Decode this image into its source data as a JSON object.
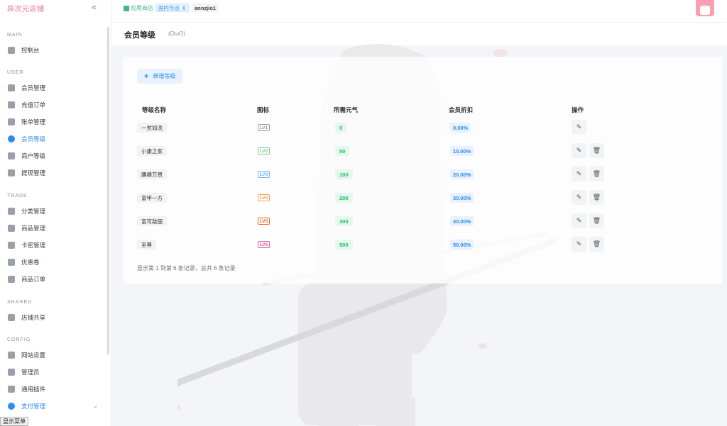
{
  "brand": "异次元店铺",
  "sidebar": {
    "sections": [
      {
        "title": "MAIN",
        "items": [
          {
            "label": "控制台",
            "icon": "dashboard-icon"
          }
        ]
      },
      {
        "title": "USER",
        "items": [
          {
            "label": "会员管理",
            "icon": "user-icon"
          },
          {
            "label": "充值订单",
            "icon": "recharge-icon"
          },
          {
            "label": "账单管理",
            "icon": "bill-icon"
          },
          {
            "label": "会员等级",
            "icon": "level-icon",
            "active": true
          },
          {
            "label": "商户等级",
            "icon": "merchant-icon"
          },
          {
            "label": "提现管理",
            "icon": "withdraw-icon"
          }
        ]
      },
      {
        "title": "TRADE",
        "items": [
          {
            "label": "分类管理",
            "icon": "category-icon"
          },
          {
            "label": "商品管理",
            "icon": "goods-icon"
          },
          {
            "label": "卡密管理",
            "icon": "card-icon"
          },
          {
            "label": "优惠卷",
            "icon": "coupon-icon"
          },
          {
            "label": "商品订单",
            "icon": "order-icon"
          }
        ]
      },
      {
        "title": "SHARED",
        "items": [
          {
            "label": "店铺共享",
            "icon": "share-icon"
          }
        ]
      },
      {
        "title": "CONFIG",
        "items": [
          {
            "label": "网站设置",
            "icon": "settings-icon"
          },
          {
            "label": "管理员",
            "icon": "admin-icon"
          },
          {
            "label": "通用插件",
            "icon": "plugin-icon"
          },
          {
            "label": "支付管理",
            "icon": "payment-icon",
            "highlight": true
          }
        ]
      }
    ],
    "menu_button": "显示菜单"
  },
  "topbar": {
    "store_link": "应用商店",
    "node": "国内节点",
    "username": "annzjio1"
  },
  "page": {
    "title": "会员等级",
    "subtitle": "(OωO)"
  },
  "table": {
    "add_button": "新增等级",
    "headers": [
      "等级名称",
      "图标",
      "所需元气",
      "会员折扣",
      "操作"
    ],
    "rows": [
      {
        "name": "一贫如洗",
        "icon": "LV1",
        "icon_color": "#9a9a9a",
        "need": "0",
        "discount": "0.00%",
        "deletable": false
      },
      {
        "name": "小康之家",
        "icon": "LV2",
        "icon_color": "#7fc97f",
        "need": "50",
        "discount": "10.00%",
        "deletable": true
      },
      {
        "name": "腰缠万贯",
        "icon": "LV3",
        "icon_color": "#6cb4e6",
        "need": "100",
        "discount": "20.00%",
        "deletable": true
      },
      {
        "name": "富甲一方",
        "icon": "LV4",
        "icon_color": "#f0a050",
        "need": "200",
        "discount": "30.00%",
        "deletable": true
      },
      {
        "name": "富可敌国",
        "icon": "LV5",
        "icon_color": "#e8691c",
        "need": "300",
        "discount": "40.00%",
        "deletable": true
      },
      {
        "name": "至尊",
        "icon": "LV6",
        "icon_color": "#e05aa5",
        "need": "500",
        "discount": "50.00%",
        "deletable": true
      }
    ],
    "footer": "显示第 1 到第 6 条记录，总共 6 条记录"
  },
  "colors": {
    "accent": "#2d8cf0",
    "brand": "#f5a3b3",
    "success": "#19be6b"
  }
}
